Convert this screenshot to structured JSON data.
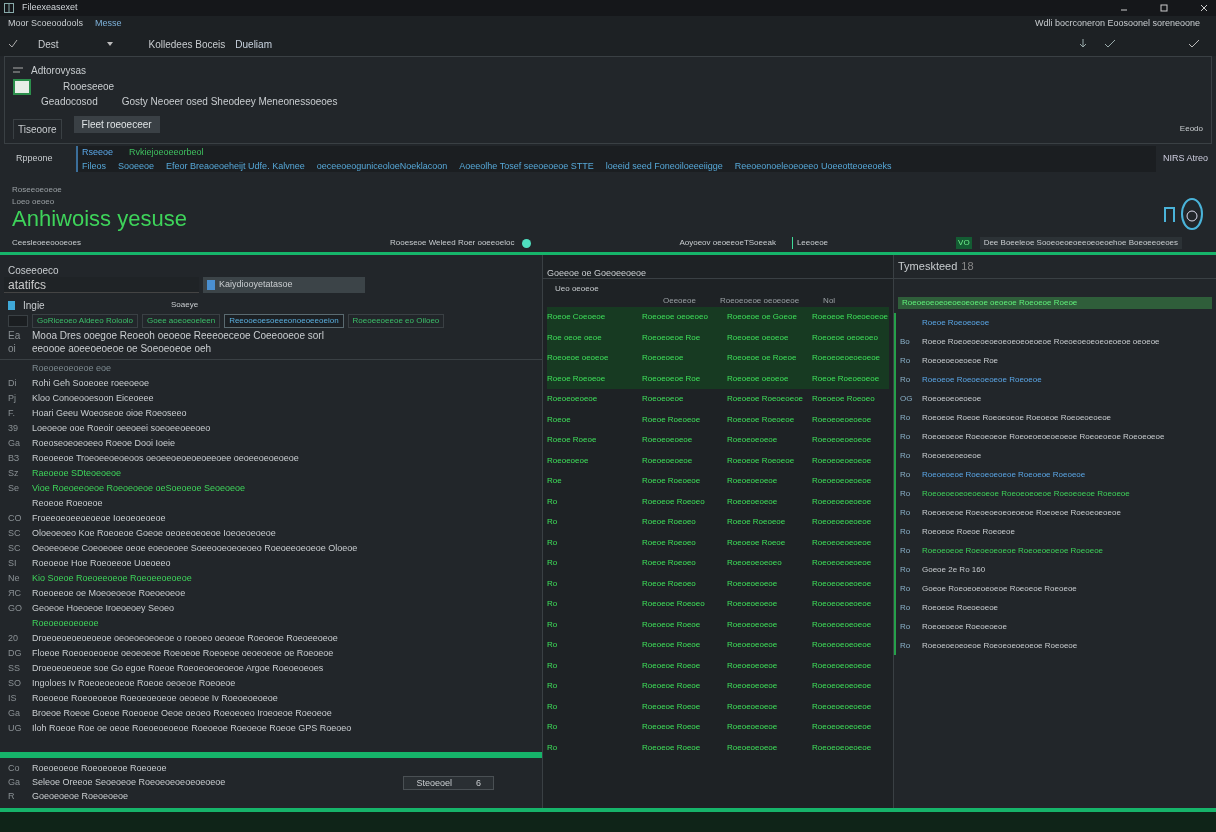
{
  "window": {
    "title": "Fileexeasexet"
  },
  "menu": {
    "items": [
      "Moor Scoeoodools",
      "Messe"
    ],
    "right_text": "Wdli bocrconeron Eoosoonel soreneoone"
  },
  "toolbar": {
    "dropdown": "Dest",
    "items": [
      "Kolledees Boceis",
      "Dueliam"
    ]
  },
  "header_panel": {
    "heading": "Adtorovysas",
    "item_title": "Rooeseeoe",
    "item_label": "Geadocosod",
    "item_desc": "Gosty Neoeer osed Sheodeey Meneonessoeoes",
    "tab": "Tiseoore",
    "button": "Fleet roeoeceer",
    "corner_text": "Eeodo"
  },
  "path_row": {
    "label": "Rppeone",
    "line1": [
      "Rseeoe",
      "Rvkiejoeoeeorbeol"
    ],
    "line2": [
      "Fileos",
      "Sooeeoe",
      "Efeor Breaoeoeheijt Udfe. Kalvnee",
      "oeceeoeoguniceoloeNoeklacoon",
      "Aoeeolhe Tosef seeoeoeoe STTE",
      "loeeid seed Foneoiloeeeiigge",
      "Reeoeonoeleoeoeeo Uoeeotteoeeoeks"
    ],
    "right_text": "NIRS Atreo"
  },
  "title_block": {
    "small1": "Roseeoeoeoe",
    "small2": "Loeo oeoeo",
    "headline": "Anhiwoiss yesuse"
  },
  "status": {
    "left": "Ceesleoeeoooeoes",
    "middle": "Rooeseoe Weleed Roer ooeeoeloc",
    "switch_on": true,
    "right_left": "Aoyoeov oeoeeoeTSoeeak",
    "right_tag": "Leeoeoe",
    "badge": "VO",
    "right": "Dee Boeeleoe Sooeoeoeoeeoeoeoehoe Boeoeeoeoes"
  },
  "left_panel": {
    "title": "Coseeoeco",
    "search": "atatifcs",
    "tab": "Kaiydiooyetatasoe",
    "col_a": "Ingie",
    "col_b": "Soaeye",
    "select_all": {
      "checked": false
    },
    "chips": [
      {
        "label": "GoRiceoeo Aldeeo Roloolo",
        "selected": false
      },
      {
        "label": "Goee aoeoeoeleen",
        "selected": false
      },
      {
        "label": "Reeooeoesoeeeonoeoeeoeion",
        "selected": true
      },
      {
        "label": "Roeoeeoeeoe eo Oiloeo",
        "selected": false
      }
    ],
    "head_rows": [
      {
        "num": "Ea",
        "text": "Mooa Dres ooegoe Reoeoh  oeoeoe Reeeoeceoe Coeeooeoe sorl"
      },
      {
        "num": "oi",
        "text": "eeoooe aoeeoeoeoe oe  Soeoeoeoe oeh"
      }
    ],
    "rows": [
      {
        "text": "Roeoeeoeoeoe  eoe",
        "kind": "faint"
      },
      {
        "num": "Di",
        "text": "Rohi Geh Sooeoee roeeoeoe",
        "kind": "plain"
      },
      {
        "num": "Pj",
        "text": "Kloo Conoeooesoon  Eiceoeee",
        "kind": "plain"
      },
      {
        "num": "F.",
        "text": "Hoari Geeu Woeoseoe oioe Roeoseeo",
        "kind": "plain"
      },
      {
        "num": "39",
        "text": "Loeoeoe ooe Roeoir oeeoeei soeoeeoeeoeo",
        "kind": "plain"
      },
      {
        "num": "Ga",
        "text": "Roeoseoeoeoeeo Roeoe Dooi  Ioeie",
        "kind": "plain"
      },
      {
        "num": "ВЗ",
        "text": "Roeoeeoe Troeoeeoeoeoos oeoeeoeoeoeoeeoee oeoeeoeoeoeoe",
        "kind": "plain"
      },
      {
        "num": "Sz",
        "text": "Raeoeoe SDteoeoeoe",
        "kind": "green"
      },
      {
        "num": "Se",
        "text": "Vioe Roeoeeoeoe  Roeoeoeoe oeSoeoeoe Seoeoeoe",
        "kind": "green"
      },
      {
        "text": "Reoeoe  Roeoeoe",
        "kind": "plain"
      },
      {
        "num": "CO",
        "text": "Froeeoeoeeoeoeoe  Ioeoeoeoeoe",
        "kind": "plain"
      },
      {
        "num": "SC",
        "text": "Oloeoeoeo Koe Roeoeoe Goeoe oeoeeoeoeoe Ioeoeoeoeoe",
        "kind": "plain"
      },
      {
        "num": "SC",
        "text": "Oeoeeoeoe  Coeoeoee oeoe eoeoeoee Soeeooeoeoeoeo Roeoeeoeoeoe Oloeoe",
        "kind": "plain"
      },
      {
        "num": "SI",
        "text": "Roeoeoe Hoe  Roeoeeoe Uoeoeeo",
        "kind": "plain"
      },
      {
        "num": "Ne",
        "text": "Kio Soeoe  Roeoeeoeoe Roeoeeoeoeoe",
        "kind": "green"
      },
      {
        "num": "ЯС",
        "text": "Roeoeeoe oe Moeoeoeoe  Roeoeoeoe",
        "kind": "plain"
      },
      {
        "num": "GO",
        "text": "Geoeoe Hoeoeoe Iroeoeoey Seoeo",
        "kind": "plain"
      },
      {
        "text": "Roeoeoeoeoeoe",
        "kind": "green"
      },
      {
        "num": "20",
        "text": "Droeoeoeoeoeoeoe oeoeoeoeoeoe o roeoeo oeoeoe Roeoeoe Roeoeeoeoe",
        "kind": "plain"
      },
      {
        "num": "DG",
        "text": "Floeoe Roeoeoeoeoe oeoeoeoe  Roeoeoe  Roeoeoe oeoeoeoe oe Roeoeoe",
        "kind": "plain"
      },
      {
        "num": "SS",
        "text": "Droeoeoeoeoe soe Go egoe Roeoe  Roeoeoeoeoeoe Argoe Roeoeoeoes",
        "kind": "plain"
      },
      {
        "num": "SO",
        "text": "Ingoloes Iv Roeoeoeoeoe  Roeoe oeoeoe  Roeoeoe",
        "kind": "plain"
      },
      {
        "num": "IS",
        "text": "Roeoeoe Roeoeoeoe Roeoeoeoeoe oeoeoe Iv Roeoeoeoeoe",
        "kind": "plain"
      },
      {
        "num": "Ga",
        "text": "Broeoe Roeoe Goeoe Roeoeoe Oeoe oeoeo Roeoeoeo Iroeoeoe Roeoeoe",
        "kind": "plain"
      },
      {
        "num": "UG",
        "text": "Iloh Roeoe Roe oe oeoe Roeoeoeoeoe Roeoeoe  Roeoeoe Roeoe  GPS Roeoeo",
        "kind": "plain"
      }
    ]
  },
  "left_footer": {
    "rows": [
      {
        "num": "Co",
        "text": "Roeoeoeoe Roeoeoeoe Roeoeoe"
      },
      {
        "num": "Ga",
        "text": "Seleoe Oreeoe Seoeoeoe  Roeoeoeoeoeoeoeoe"
      },
      {
        "num": "R",
        "text": "Goeoeoeoe Roeoeoeoe"
      }
    ],
    "button": "Steoeoel",
    "count": "6"
  },
  "mid_panel": {
    "title": "Goeeoe oe Goeoeeoeoe",
    "subtitle": "Ueo oeoeoe",
    "headers": [
      "Oeeoeoe",
      "Roeoeoeoe oeoeoeoe",
      "Nol"
    ],
    "rows": [
      [
        "Roeoe Coeoeoe",
        "Roeoeoe oeoeoeo",
        "Roeoeoe oe Goeoe",
        "Roeoeoe Roeoeoeoe"
      ],
      [
        "Roe oeoe oeoe",
        "Roeoeoeoe Roe",
        "Roeoeoe oeoeoe",
        "Roeoeoe oeoeoeo"
      ],
      [
        "Roeoeoe oeoeoe",
        "Roeoeoeoe",
        "Roeoeoe oe Roeoe",
        "Roeoeoeoeoeoeoe"
      ],
      [
        "Roeoe Roeoeoe",
        "Roeoeoeoe Roe",
        "Roeoeoe oeoeoe",
        "Roeoe Roeoeoeoe"
      ],
      [
        "Roeoeoeoeoe",
        "Roeoeoeoe",
        "Roeoeoe Roeoeoeoe",
        "Roeoeoe Roeoeo"
      ],
      [
        "Roeoe",
        "Roeoe Roeoeoe",
        "Roeoeoe Roeoeoe",
        "Roeoeoeoeoeoe"
      ],
      [
        "Roeoe Roeoe",
        "Roeoeoeoeoe",
        "Roeoeoeoeoe",
        "Roeoeoeoeoeoe"
      ],
      [
        "Roeoeoeoe",
        "Roeoeoeoeoe",
        "Roeoeoe Roeoeoe",
        "Roeoeoeoeoeoe"
      ],
      [
        "Roe",
        "Roeoe Roeoeoe",
        "Roeoeoeoeoe",
        "Roeoeoeoeoeoe"
      ],
      [
        "Ro",
        "Roeoeoe Roeoeo",
        "Roeoeoeoeoe",
        "Roeoeoeoeoeoe"
      ],
      [
        "Ro",
        "Roeoe Roeoeo",
        "Roeoe Roeoeoe",
        "Roeoeoeoeoeoe"
      ],
      [
        "Ro",
        "Roeoe Roeoeo",
        "Roeoeoe Roeoe",
        "Roeoeoeoeoeoe"
      ],
      [
        "Ro",
        "Roeoe Roeoeo",
        "Roeoeoeoeoeo",
        "Roeoeoeoeoeoe"
      ],
      [
        "Ro",
        "Roeoe Roeoeo",
        "Roeoeoeoeoe",
        "Roeoeoeoeoeoe"
      ],
      [
        "Ro",
        "Roeoeoe Roeoeo",
        "Roeoeoeoeoe",
        "Roeoeoeoeoeoe"
      ],
      [
        "Ro",
        "Roeoeoe Roeoe",
        "Roeoeoeoeoe",
        "Roeoeoeoeoeoe"
      ],
      [
        "Ro",
        "Roeoeoe Roeoe",
        "Roeoeoeoeoe",
        "Roeoeoeoeoeoe"
      ],
      [
        "Ro",
        "Roeoeoe Roeoe",
        "Roeoeoeoeoe",
        "Roeoeoeoeoeoe"
      ],
      [
        "Ro",
        "Roeoeoe Roeoe",
        "Roeoeoeoeoe",
        "Roeoeoeoeoeoe"
      ],
      [
        "Ro",
        "Roeoeoe Roeoe",
        "Roeoeoeoeoe",
        "Roeoeoeoeoeoe"
      ],
      [
        "Ro",
        "Roeoeoe Roeoe",
        "Roeoeoeoeoe",
        "Roeoeoeoeoeoe"
      ],
      [
        "Ro",
        "Roeoeoe Roeoe",
        "Roeoeoeoeoe",
        "Roeoeoeoeoeoe"
      ]
    ]
  },
  "right_panel": {
    "title": "Tymeskteed",
    "count": "18",
    "banner": "Roeoeoeoeoeoeoeoeoe oeoeoe Roeoeoe Roeoe",
    "items": [
      {
        "text": "Roeoe Roeoeoeoe",
        "kind": "blue"
      },
      {
        "num": "Bo",
        "text": "Roeoe Roeoeoeoeoeoeoeoeoeoeoe Roeoeoeoeoeoeoeoe oeoeoe",
        "kind": "plain"
      },
      {
        "num": "Ro",
        "text": "Roeoeoeoeoeoe Roe",
        "kind": "plain"
      },
      {
        "num": "Ro",
        "text": "Roeoeoe Roeoeoeoeoe Roeoeoe",
        "kind": "blue"
      },
      {
        "num": "OG",
        "text": "Roeoeoeoeoeoe",
        "kind": "plain"
      },
      {
        "num": "Ro",
        "text": "Roeoeoe Roeoe Roeoeoeoe Roeoeoe Roeoeoeoeoe",
        "kind": "plain"
      },
      {
        "num": "Ro",
        "text": "Roeoeoeoe Roeoeoeoe Roeoeoeoeoeoeoe Roeoeoeoe Roeoeoeoe",
        "kind": "plain"
      },
      {
        "num": "Ro",
        "text": "Roeoeoeoeoeoe",
        "kind": "plain"
      },
      {
        "num": "Ro",
        "text": "Roeoeoeoe Roeoeoeoeoe Roeoeoe Roeoeoe",
        "kind": "blue"
      },
      {
        "num": "Ro",
        "text": "Roeoeoeoeoeoeoeoe Roeoeoeoeoe Roeoeoeoe Roeoeoe",
        "kind": "green"
      },
      {
        "num": "Ro",
        "text": "Roeoeoeoe Roeoeoeoeoeoeoe Roeoeoe Roeoeoeoeoe",
        "kind": "plain"
      },
      {
        "num": "Ro",
        "text": "Roeoeoe Roeoe Roeoeoe",
        "kind": "plain"
      },
      {
        "num": "Ro",
        "text": "Roeoeoeoe Roeoeoeoeoe Roeoeoeoeoe Roeoeoe",
        "kind": "green"
      },
      {
        "num": "Ro",
        "text": "Goeoe 2e Ro 160",
        "kind": "plain"
      },
      {
        "num": "Ro",
        "text": "Goeoe Roeoeoeoeoeoe Roeoeoe Roeoeoe",
        "kind": "plain"
      },
      {
        "num": "Ro",
        "text": "Roeoeoe Roeoeoeoe",
        "kind": "plain"
      },
      {
        "num": "Ro",
        "text": "Roeoeoeoe Roeoeoeoe",
        "kind": "plain"
      },
      {
        "num": "Ro",
        "text": "Roeoeoeoeoeoe Roeoeoeoeoeoe Roeoeoe",
        "kind": "plain"
      }
    ]
  }
}
